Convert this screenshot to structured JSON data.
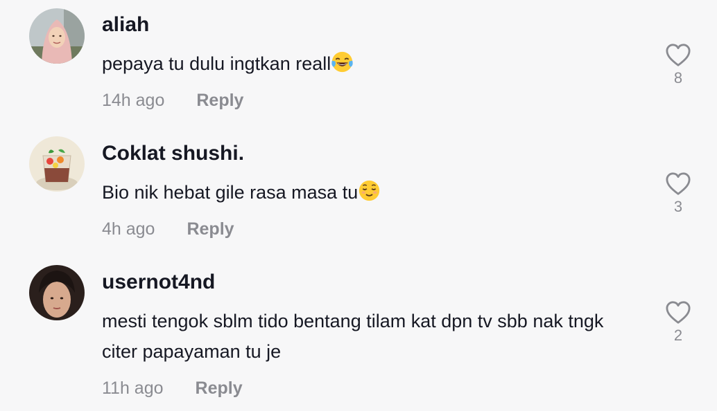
{
  "comments": [
    {
      "username": "aliah",
      "text": "pepaya tu dulu ingtkan reall",
      "emoji": "face-with-tears-of-joy",
      "time": "14h ago",
      "reply_label": "Reply",
      "likes": "8"
    },
    {
      "username": "Coklat shushi.",
      "text": "Bio nik hebat gile rasa masa tu",
      "emoji": "relieved-face",
      "time": "4h ago",
      "reply_label": "Reply",
      "likes": "3"
    },
    {
      "username": "usernot4nd",
      "text": "mesti tengok sblm tido bentang tilam kat dpn tv sbb nak tngk citer papayaman tu je",
      "time": "11h ago",
      "reply_label": "Reply",
      "likes": "2"
    }
  ],
  "icons": {
    "like": "heart-outline-icon"
  },
  "colors": {
    "background": "#f7f7f8",
    "text": "#161823",
    "secondary": "#8a8b91"
  }
}
